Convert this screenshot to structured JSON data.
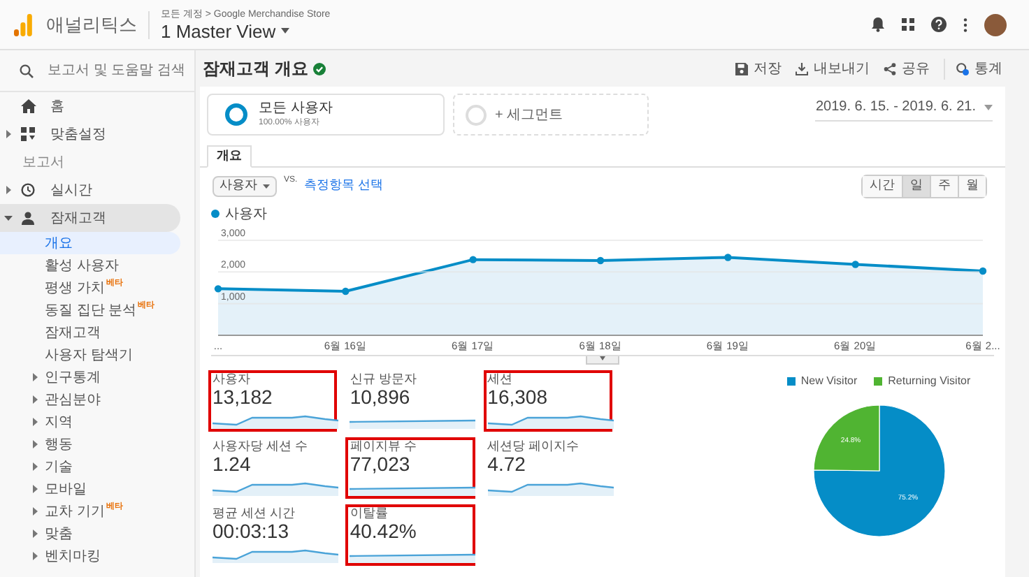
{
  "header": {
    "app_name": "애널리틱스",
    "breadcrumb": "모든 계정 > Google Merchandise Store",
    "view": "1 Master View"
  },
  "sidebar": {
    "search_placeholder": "보고서 및 도움말 검색",
    "top_items": [
      {
        "label": "홈",
        "expandable": false
      },
      {
        "label": "맞춤설정",
        "expandable": true
      }
    ],
    "section_label": "보고서",
    "report_items": [
      {
        "label": "실시간",
        "expanded": false
      },
      {
        "label": "잠재고객",
        "expanded": true,
        "children": [
          {
            "label": "개요",
            "selected": true,
            "expandable": false
          },
          {
            "label": "활성 사용자",
            "selected": false,
            "expandable": false
          },
          {
            "label": "평생 가치",
            "badge": "베타",
            "selected": false,
            "expandable": false
          },
          {
            "label": "동질 집단 분석",
            "badge": "베타",
            "selected": false,
            "expandable": false
          },
          {
            "label": "잠재고객",
            "selected": false,
            "expandable": false
          },
          {
            "label": "사용자 탐색기",
            "selected": false,
            "expandable": false
          },
          {
            "label": "인구통계",
            "selected": false,
            "expandable": true
          },
          {
            "label": "관심분야",
            "selected": false,
            "expandable": true
          },
          {
            "label": "지역",
            "selected": false,
            "expandable": true
          },
          {
            "label": "행동",
            "selected": false,
            "expandable": true
          },
          {
            "label": "기술",
            "selected": false,
            "expandable": true
          },
          {
            "label": "모바일",
            "selected": false,
            "expandable": true
          },
          {
            "label": "교차 기기",
            "badge": "베타",
            "selected": false,
            "expandable": true
          },
          {
            "label": "맞춤",
            "selected": false,
            "expandable": true
          },
          {
            "label": "벤치마킹",
            "selected": false,
            "expandable": true
          }
        ]
      }
    ]
  },
  "page": {
    "title": "잠재고객 개요",
    "actions": [
      {
        "label": "저장"
      },
      {
        "label": "내보내기"
      },
      {
        "label": "공유"
      },
      {
        "label": "통계"
      }
    ],
    "segments": [
      {
        "kind": "active",
        "name": "모든 사용자",
        "detail": "100.00% 사용자"
      },
      {
        "kind": "add",
        "name": "+ 세그먼트"
      }
    ],
    "date_range": "2019. 6. 15. - 2019. 6. 21.",
    "tabs": [
      {
        "label": "개요",
        "selected": true
      }
    ],
    "metric_select": "사용자",
    "vs": "VS.",
    "compare_link": "측정항목 선택",
    "granularity": [
      {
        "label": "시간",
        "selected": false
      },
      {
        "label": "일",
        "selected": true
      },
      {
        "label": "주",
        "selected": false
      },
      {
        "label": "월",
        "selected": false
      }
    ],
    "line_chart": {
      "chart_data": {
        "type": "area",
        "categories": [
          "...",
          "6월 16일",
          "6월 17일",
          "6월 18일",
          "6월 19일",
          "6월 20일",
          "6월 2..."
        ],
        "series": [
          {
            "name": "사용자",
            "color": "#058dc7",
            "marker": "circle",
            "values": [
              1470,
              1390,
              2390,
              2360,
              2460,
              2240,
              2030
            ]
          }
        ],
        "ylim": [
          0,
          3000
        ],
        "yticks": [
          {
            "value": 1000,
            "label": "1,000"
          },
          {
            "value": 2000,
            "label": "2,000"
          },
          {
            "value": 3000,
            "label": "3,000"
          }
        ]
      }
    },
    "metrics": [
      {
        "label": "사용자",
        "value": "13,182",
        "highlighted": true
      },
      {
        "label": "신규 방문자",
        "value": "10,896",
        "highlighted": false
      },
      {
        "label": "세션",
        "value": "16,308",
        "highlighted": true
      },
      {
        "label": "사용자당 세션 수",
        "value": "1.24",
        "highlighted": false
      },
      {
        "label": "페이지뷰 수",
        "value": "77,023",
        "highlighted": true
      },
      {
        "label": "세션당 페이지수",
        "value": "4.72",
        "highlighted": false
      },
      {
        "label": "평균 세션 시간",
        "value": "00:03:13",
        "highlighted": false
      },
      {
        "label": "이탈률",
        "value": "40.42%",
        "highlighted": true
      }
    ],
    "pie": {
      "chart_data": {
        "type": "pie",
        "legend": "top",
        "categories": [
          "New Visitor",
          "Returning Visitor"
        ],
        "colors": [
          "#058dc7",
          "#50b432"
        ],
        "values": [
          75.2,
          24.8
        ],
        "value_labels": [
          "75.2%",
          "24.8%"
        ]
      }
    }
  }
}
